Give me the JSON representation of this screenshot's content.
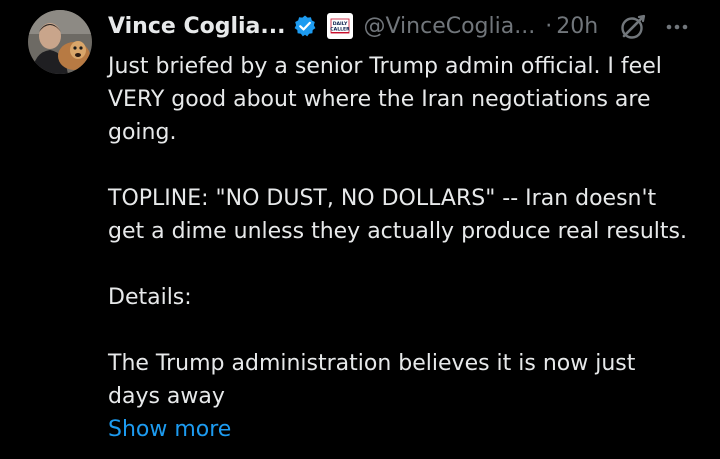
{
  "author": {
    "display_name": "Vince Coglia...",
    "handle": "@VinceCoglia...",
    "separator": "·",
    "time_ago": "20h",
    "affiliation_badge": [
      "DAILY",
      "CALLER"
    ],
    "verified_icon": "verified-badge-icon",
    "verified_color": "#1d9bf0"
  },
  "actions": {
    "grok_icon": "grok-icon",
    "more_icon": "more-options-icon"
  },
  "tweet": {
    "lines": [
      "Just briefed by a senior Trump admin official. I feel",
      "VERY good about where the Iran negotiations are",
      "going.",
      "",
      "TOPLINE: \"NO DUST, NO DOLLARS\" -- Iran doesn't",
      "get a dime unless they actually produce real results.",
      "",
      "Details:",
      "",
      "The Trump administration believes it is now just",
      "days away"
    ],
    "show_more_label": "Show more"
  },
  "colors": {
    "background": "#000000",
    "text": "#e7e9ea",
    "secondary": "#71767b",
    "link": "#1d9bf0"
  }
}
